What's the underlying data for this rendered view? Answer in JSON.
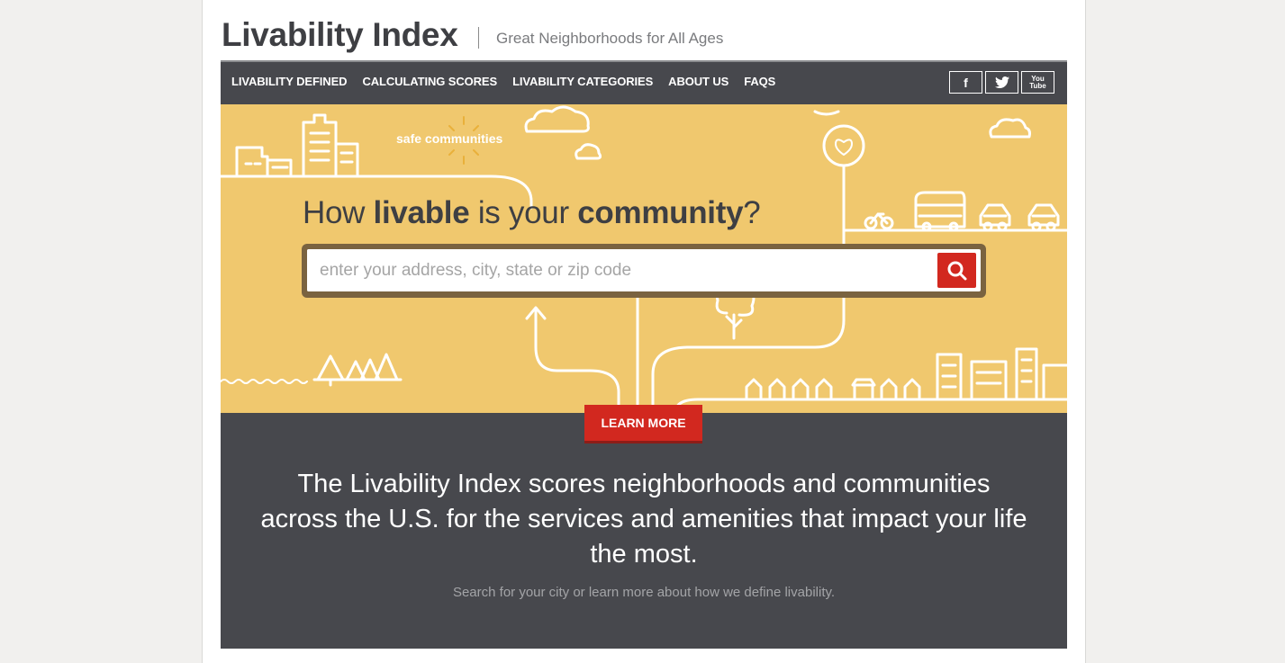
{
  "header": {
    "site_title": "Livability Index",
    "tagline": "Great Neighborhoods for All Ages"
  },
  "nav": {
    "items": [
      {
        "label": "LIVABILITY DEFINED"
      },
      {
        "label": "CALCULATING SCORES"
      },
      {
        "label": "LIVABILITY CATEGORIES"
      },
      {
        "label": "ABOUT US"
      },
      {
        "label": "FAQS"
      }
    ],
    "social": [
      {
        "icon": "facebook-icon",
        "label": "f"
      },
      {
        "icon": "twitter-icon"
      },
      {
        "icon": "youtube-icon",
        "label_top": "You",
        "label_bottom": "Tube"
      }
    ]
  },
  "hero": {
    "headline_part1": "How ",
    "headline_bold1": "livable",
    "headline_part2": " is your ",
    "headline_bold2": "community",
    "headline_part3": "?",
    "illustration_label": "safe communities",
    "search_placeholder": "enter your address, city, state or zip code",
    "search_icon": "search-icon"
  },
  "cta": {
    "learn_more_label": "LEARN MORE",
    "blurb": "The Livability Index scores neighborhoods and communities across the U.S. for the services and amenities that impact your life the most.",
    "subtext": "Search for your city or learn more about how we define livability."
  },
  "colors": {
    "hero_background": "#f0c86e",
    "nav_background": "#47484d",
    "accent_red": "#d2281f",
    "search_border": "#7a6340"
  }
}
